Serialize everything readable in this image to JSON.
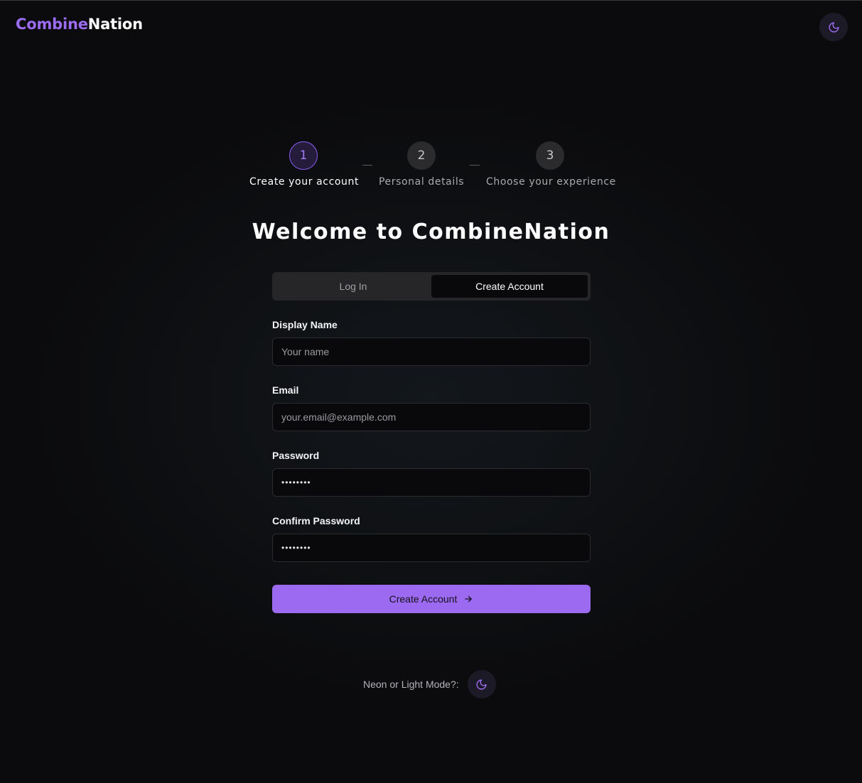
{
  "brand": {
    "part1": "Combine",
    "part2": "Nation"
  },
  "steps": [
    {
      "number": "1",
      "label": "Create your account",
      "active": true
    },
    {
      "number": "2",
      "label": "Personal details",
      "active": false
    },
    {
      "number": "3",
      "label": "Choose your experience",
      "active": false
    }
  ],
  "heading": "Welcome to CombineNation",
  "tabs": {
    "login": "Log In",
    "create": "Create Account",
    "active": "create"
  },
  "form": {
    "display_name": {
      "label": "Display Name",
      "placeholder": "Your name",
      "value": ""
    },
    "email": {
      "label": "Email",
      "placeholder": "your.email@example.com",
      "value": ""
    },
    "password": {
      "label": "Password",
      "value": "••••••••"
    },
    "confirm_password": {
      "label": "Confirm Password",
      "value": "••••••••"
    },
    "submit_label": "Create Account"
  },
  "mode_toggle": {
    "label": "Neon or Light Mode?:"
  },
  "icons": {
    "theme_toggle": "moon-icon",
    "submit_arrow": "arrow-right-icon"
  },
  "colors": {
    "accent": "#9b6af0",
    "background": "#0b0b0d",
    "input_bg": "#09090b"
  }
}
